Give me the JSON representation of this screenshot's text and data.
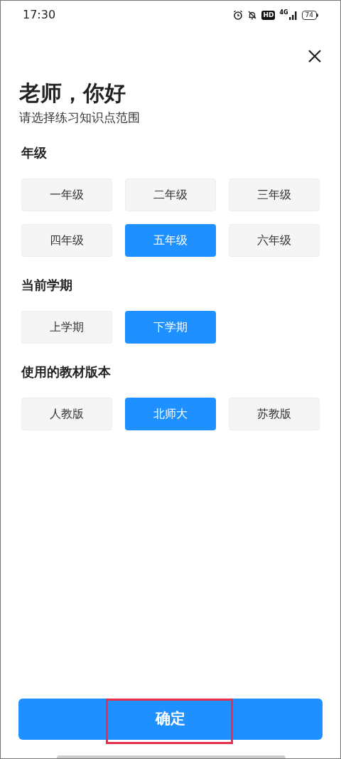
{
  "status_bar": {
    "time": "17:30",
    "hd": "HD",
    "network": "4G",
    "battery": "74"
  },
  "title": "老师，你好",
  "subtitle": "请选择练习知识点范围",
  "sections": [
    {
      "label": "年级",
      "options": [
        {
          "label": "一年级",
          "selected": false
        },
        {
          "label": "二年级",
          "selected": false
        },
        {
          "label": "三年级",
          "selected": false
        },
        {
          "label": "四年级",
          "selected": false
        },
        {
          "label": "五年级",
          "selected": true
        },
        {
          "label": "六年级",
          "selected": false
        }
      ]
    },
    {
      "label": "当前学期",
      "options": [
        {
          "label": "上学期",
          "selected": false
        },
        {
          "label": "下学期",
          "selected": true
        }
      ]
    },
    {
      "label": "使用的教材版本",
      "options": [
        {
          "label": "人教版",
          "selected": false
        },
        {
          "label": "北师大",
          "selected": true
        },
        {
          "label": "苏教版",
          "selected": false
        }
      ]
    }
  ],
  "confirm": {
    "label": "确定",
    "highlighted": true
  }
}
